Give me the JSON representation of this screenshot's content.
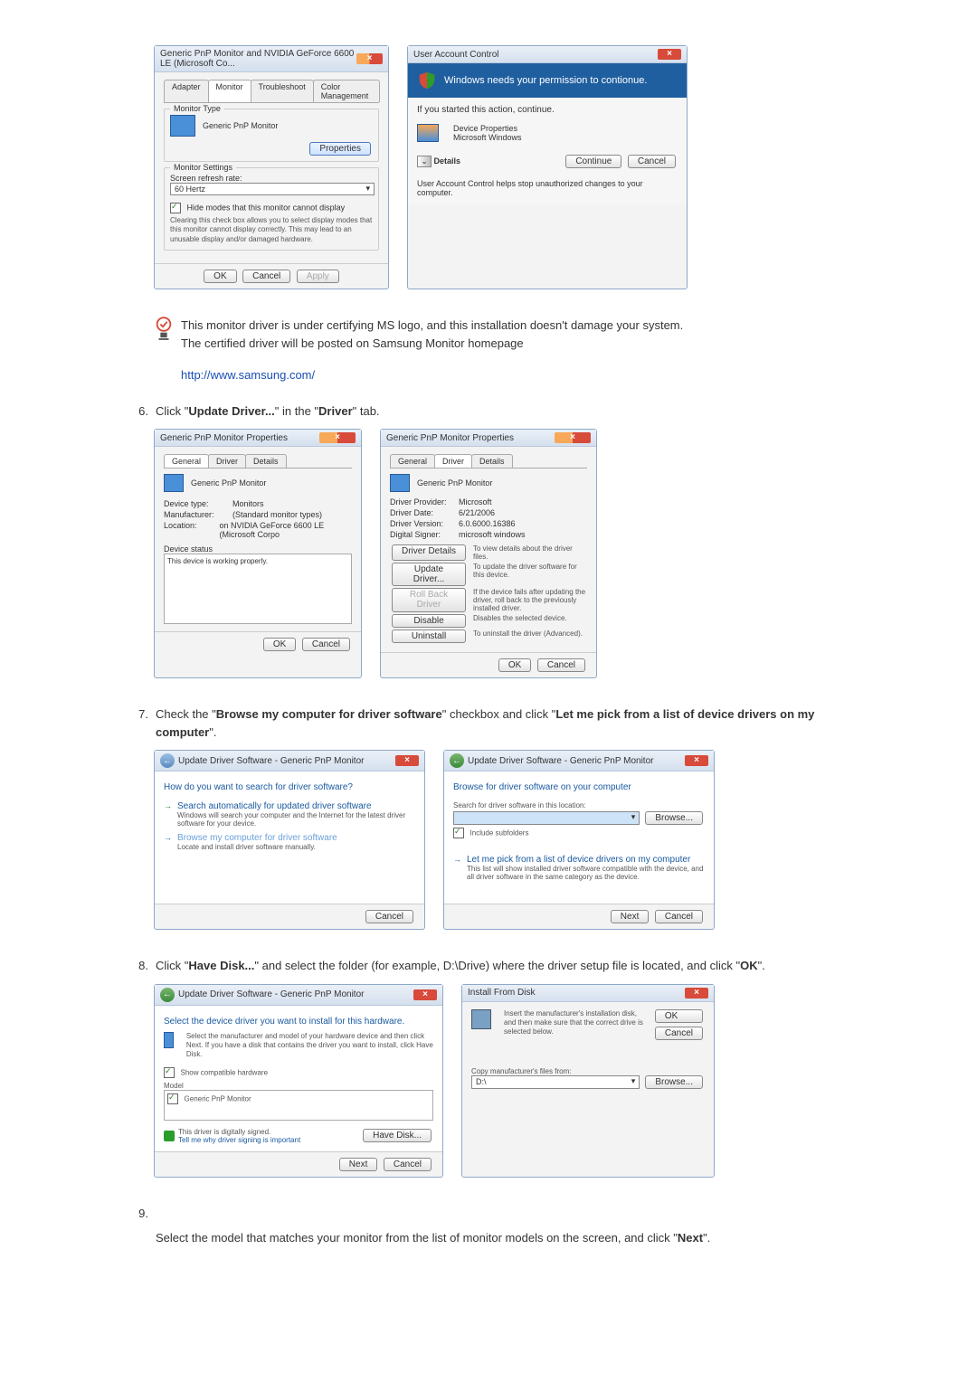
{
  "top_row": {
    "monitor_dialog": {
      "title": "Generic PnP Monitor and NVIDIA GeForce 6600 LE (Microsoft Co...",
      "tabs": [
        "Adapter",
        "Monitor",
        "Troubleshoot",
        "Color Management"
      ],
      "group1_label": "Monitor Type",
      "monitor_name": "Generic PnP Monitor",
      "properties_btn": "Properties",
      "group2_label": "Monitor Settings",
      "refresh_label": "Screen refresh rate:",
      "refresh_value": "60 Hertz",
      "hide_modes_checkbox": "Hide modes that this monitor cannot display",
      "hide_modes_desc": "Clearing this check box allows you to select display modes that this monitor cannot display correctly. This may lead to an unusable display and/or damaged hardware.",
      "btn_ok": "OK",
      "btn_cancel": "Cancel",
      "btn_apply": "Apply"
    },
    "uac": {
      "title": "User Account Control",
      "heading": "Windows needs your permission to contionue.",
      "started": "If you started this action, continue.",
      "program": "Device Properties",
      "publisher": "Microsoft Windows",
      "details": "Details",
      "continue": "Continue",
      "cancel": "Cancel",
      "footer": "User Account Control helps stop unauthorized changes to your computer."
    }
  },
  "note": {
    "line1": "This monitor driver is under certifying MS logo, and this installation doesn't damage your system.",
    "line2": "The certified driver will be posted on Samsung Monitor homepage",
    "url": "http://www.samsung.com/"
  },
  "step6": {
    "num": "6.",
    "text_before": "Click \"",
    "bold1": "Update Driver...",
    "mid": "\" in the \"",
    "bold2": "Driver",
    "after": "\" tab.",
    "left": {
      "title": "Generic PnP Monitor Properties",
      "tabs": [
        "General",
        "Driver",
        "Details"
      ],
      "name": "Generic PnP Monitor",
      "rows": [
        [
          "Device type:",
          "Monitors"
        ],
        [
          "Manufacturer:",
          "(Standard monitor types)"
        ],
        [
          "Location:",
          "on NVIDIA GeForce 6600 LE (Microsoft Corpo"
        ]
      ],
      "status_label": "Device status",
      "status": "This device is working properly.",
      "ok": "OK",
      "cancel": "Cancel"
    },
    "right": {
      "title": "Generic PnP Monitor Properties",
      "tabs": [
        "General",
        "Driver",
        "Details"
      ],
      "name": "Generic PnP Monitor",
      "rows": [
        [
          "Driver Provider:",
          "Microsoft"
        ],
        [
          "Driver Date:",
          "6/21/2006"
        ],
        [
          "Driver Version:",
          "6.0.6000.16386"
        ],
        [
          "Digital Signer:",
          "microsoft windows"
        ]
      ],
      "buttons": [
        [
          "Driver Details",
          "To view details about the driver files."
        ],
        [
          "Update Driver...",
          "To update the driver software for this device."
        ],
        [
          "Roll Back Driver",
          "If the device fails after updating the driver, roll back to the previously installed driver."
        ],
        [
          "Disable",
          "Disables the selected device."
        ],
        [
          "Uninstall",
          "To uninstall the driver (Advanced)."
        ]
      ],
      "ok": "OK",
      "cancel": "Cancel"
    }
  },
  "step7": {
    "num": "7.",
    "text": "Check the \"",
    "bold1": "Browse my computer for driver software",
    "mid": "\" checkbox and click \"",
    "bold2": "Let me pick from a list of device drivers on my computer",
    "after": "\".",
    "left": {
      "crumb": "Update Driver Software - Generic PnP Monitor",
      "heading": "How do you want to search for driver software?",
      "opt1_title": "Search automatically for updated driver software",
      "opt1_desc": "Windows will search your computer and the Internet for the latest driver software for your device.",
      "opt2_title": "Browse my computer for driver software",
      "opt2_desc": "Locate and install driver software manually.",
      "cancel": "Cancel"
    },
    "right": {
      "crumb": "Update Driver Software - Generic PnP Monitor",
      "heading": "Browse for driver software on your computer",
      "search_label": "Search for driver software in this location:",
      "browse": "Browse...",
      "include": "Include subfolders",
      "opt_title": "Let me pick from a list of device drivers on my computer",
      "opt_desc": "This list will show installed driver software compatible with the device, and all driver software in the same category as the device.",
      "next": "Next",
      "cancel": "Cancel"
    }
  },
  "step8": {
    "num": "8.",
    "text": "Click \"",
    "bold1": "Have Disk...",
    "mid": "\" and select the folder (for example, D:\\Drive) where the driver setup file is located, and click \"",
    "bold2": "OK",
    "after": "\".",
    "left": {
      "crumb": "Update Driver Software - Generic PnP Monitor",
      "heading": "Select the device driver you want to install for this hardware.",
      "desc": "Select the manufacturer and model of your hardware device and then click Next. If you have a disk that contains the driver you want to install, click Have Disk.",
      "compat": "Show compatible hardware",
      "model_label": "Model",
      "model": "Generic PnP Monitor",
      "signed": "This driver is digitally signed.",
      "signed_link": "Tell me why driver signing is important",
      "have_disk": "Have Disk...",
      "next": "Next",
      "cancel": "Cancel"
    },
    "right": {
      "title": "Install From Disk",
      "desc": "Insert the manufacturer's installation disk, and then make sure that the correct drive is selected below.",
      "ok": "OK",
      "cancel": "Cancel",
      "copy_label": "Copy manufacturer's files from:",
      "path": "D:\\",
      "browse": "Browse..."
    }
  },
  "step9": {
    "num": "9.",
    "text_before": "Select the model that matches your monitor from the list of monitor models on the screen, and click \"",
    "bold": "Next",
    "after": "\"."
  }
}
